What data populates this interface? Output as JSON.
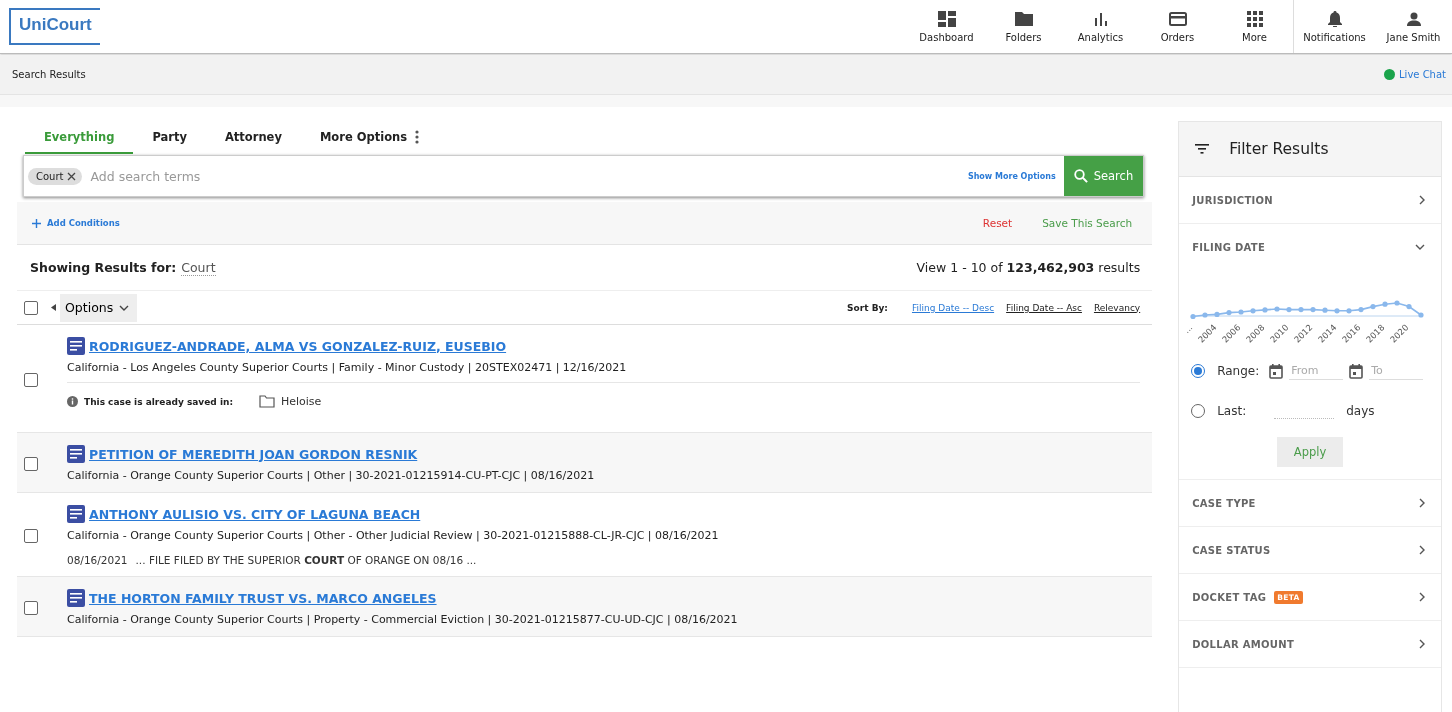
{
  "logo": "UniCourt",
  "nav": [
    {
      "kind": "dashboard",
      "label": "Dashboard"
    },
    {
      "kind": "folders",
      "label": "Folders"
    },
    {
      "kind": "analytics",
      "label": "Analytics"
    },
    {
      "kind": "orders",
      "label": "Orders"
    },
    {
      "kind": "more",
      "label": "More"
    },
    {
      "kind": "notifications",
      "label": "Notifications"
    },
    {
      "kind": "user",
      "label": "Jane Smith"
    }
  ],
  "breadcrumb": "Search Results",
  "live_chat": {
    "label": "Live Chat",
    "color": "#1aa34a"
  },
  "tabs": [
    {
      "label": "Everything",
      "selected": true
    },
    {
      "label": "Party",
      "selected": false
    },
    {
      "label": "Attorney",
      "selected": false
    },
    {
      "label": "More Options",
      "selected": false
    }
  ],
  "search": {
    "chip": "Court",
    "placeholder": "Add search terms",
    "more_options": "Show More Options",
    "button": "Search"
  },
  "conditions": {
    "add": "Add Conditions",
    "reset": "Reset",
    "save": "Save This Search"
  },
  "summary": {
    "label": "Showing Results for:",
    "query": "Court",
    "count_prefix": "View 1 - 10 of",
    "count": "123,462,903",
    "count_suffix": "results"
  },
  "toolbar": {
    "select_all_checked": false,
    "options": "Options",
    "sort_label": "Sort By:",
    "sort_options": [
      {
        "label": "Filing Date -- Desc",
        "selected": true
      },
      {
        "label": "Filing Date -- Asc",
        "selected": false
      },
      {
        "label": "Relevancy",
        "selected": false
      }
    ]
  },
  "results": [
    {
      "checked": false,
      "title": "RODRIGUEZ-ANDRADE, ALMA VS GONZALEZ-RUIZ, EUSEBIO",
      "meta": "California - Los Angeles County Superior Courts | Family - Minor Custody | 20STEX02471 | 12/16/2021",
      "saved_label": "This case is already saved in:",
      "saved_folder": "Heloise"
    },
    {
      "checked": false,
      "title": "PETITION OF MEREDITH JOAN GORDON RESNIK",
      "meta": "California - Orange County Superior Courts | Other | 30-2021-01215914-CU-PT-CJC | 08/16/2021"
    },
    {
      "checked": false,
      "title": "ANTHONY AULISIO VS. CITY OF LAGUNA BEACH",
      "meta": "California - Orange County Superior Courts | Other - Other Judicial Review | 30-2021-01215888-CL-JR-CJC | 08/16/2021",
      "snippet_date": "08/16/2021",
      "snippet": "... FILE FILED BY THE SUPERIOR **COURT** OF ORANGE ON 08/16 ..."
    },
    {
      "checked": false,
      "title": "THE HORTON FAMILY TRUST VS. MARCO ANGELES",
      "meta": "California - Orange County Superior Courts | Property - Commercial Eviction | 30-2021-01215877-CU-UD-CJC | 08/16/2021"
    }
  ],
  "filter": {
    "title": "Filter Results",
    "sections": [
      {
        "kind": "plain",
        "label": "JURISDICTION",
        "expanded": false
      },
      {
        "kind": "date",
        "label": "FILING DATE",
        "expanded": true,
        "axis_labels": [
          "...",
          "2004",
          "2006",
          "2008",
          "2010",
          "2012",
          "2014",
          "2016",
          "2018",
          "2020"
        ],
        "range": {
          "label": "Range:",
          "selected": true,
          "from_placeholder": "From",
          "to_placeholder": "To"
        },
        "last": {
          "label": "Last:",
          "selected": false,
          "unit": "days"
        },
        "apply": "Apply"
      },
      {
        "kind": "plain",
        "label": "CASE TYPE",
        "expanded": false
      },
      {
        "kind": "plain",
        "label": "CASE STATUS",
        "expanded": false
      },
      {
        "kind": "plain",
        "label": "DOCKET TAG",
        "badge": "BETA",
        "expanded": false
      },
      {
        "kind": "plain",
        "label": "DOLLAR AMOUNT",
        "expanded": false
      }
    ]
  }
}
